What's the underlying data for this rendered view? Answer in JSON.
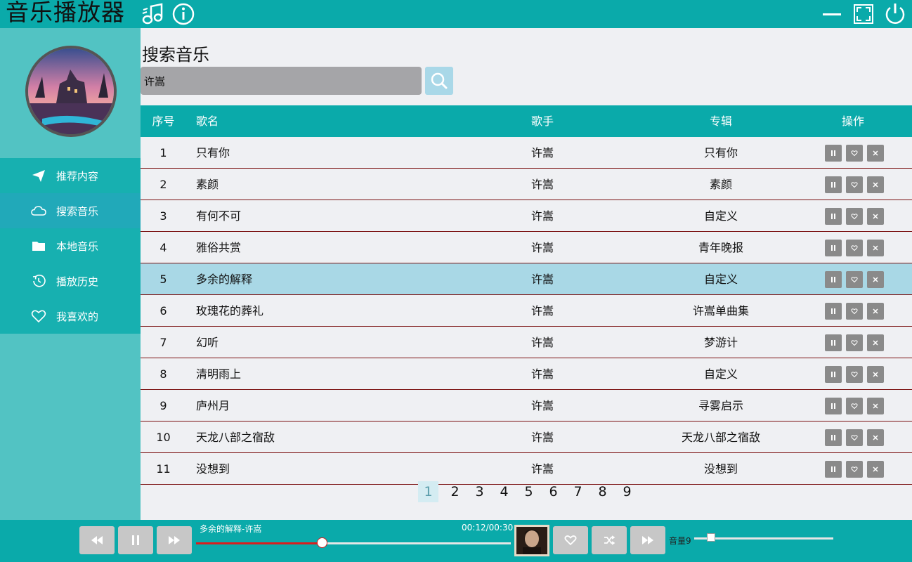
{
  "app": {
    "title": "音乐播放器"
  },
  "sidebar": {
    "items": [
      {
        "label": "推荐内容",
        "icon": "paper-plane-icon",
        "active": false
      },
      {
        "label": "搜索音乐",
        "icon": "cloud-icon",
        "active": true
      },
      {
        "label": "本地音乐",
        "icon": "folder-icon",
        "active": false
      },
      {
        "label": "播放历史",
        "icon": "history-icon",
        "active": false
      },
      {
        "label": "我喜欢的",
        "icon": "heart-icon",
        "active": false
      }
    ]
  },
  "main": {
    "title": "搜索音乐",
    "search": {
      "value": "许嵩"
    },
    "table": {
      "headers": {
        "no": "序号",
        "name": "歌名",
        "singer": "歌手",
        "album": "专辑",
        "ops": "操作"
      },
      "rows": [
        {
          "no": "1",
          "name": "只有你",
          "singer": "许嵩",
          "album": "只有你"
        },
        {
          "no": "2",
          "name": "素颜",
          "singer": "许嵩",
          "album": "素颜"
        },
        {
          "no": "3",
          "name": "有何不可",
          "singer": "许嵩",
          "album": "自定义"
        },
        {
          "no": "4",
          "name": "雅俗共赏",
          "singer": "许嵩",
          "album": "青年晚报"
        },
        {
          "no": "5",
          "name": "多余的解释",
          "singer": "许嵩",
          "album": "自定义"
        },
        {
          "no": "6",
          "name": "玫瑰花的葬礼",
          "singer": "许嵩",
          "album": "许嵩单曲集"
        },
        {
          "no": "7",
          "name": "幻听",
          "singer": "许嵩",
          "album": "梦游计"
        },
        {
          "no": "8",
          "name": "清明雨上",
          "singer": "许嵩",
          "album": "自定义"
        },
        {
          "no": "9",
          "name": "庐州月",
          "singer": "许嵩",
          "album": "寻雾启示"
        },
        {
          "no": "10",
          "name": "天龙八部之宿敌",
          "singer": "许嵩",
          "album": "天龙八部之宿敌"
        },
        {
          "no": "11",
          "name": "没想到",
          "singer": "许嵩",
          "album": "没想到"
        }
      ],
      "selected_row": 5
    },
    "pagination": {
      "pages": [
        "1",
        "2",
        "3",
        "4",
        "5",
        "6",
        "7",
        "8",
        "9"
      ],
      "current": "1"
    }
  },
  "player": {
    "now_playing": "多余的解释-许嵩",
    "time": "00:12/00:30",
    "progress": 0.4,
    "volume_label": "音量9",
    "volume": 0.09
  },
  "colors": {
    "accent": "#0aaaaa",
    "sidebar": "#52c3c3",
    "selected_row": "#a9d8e6",
    "progress": "#d81e1e"
  }
}
